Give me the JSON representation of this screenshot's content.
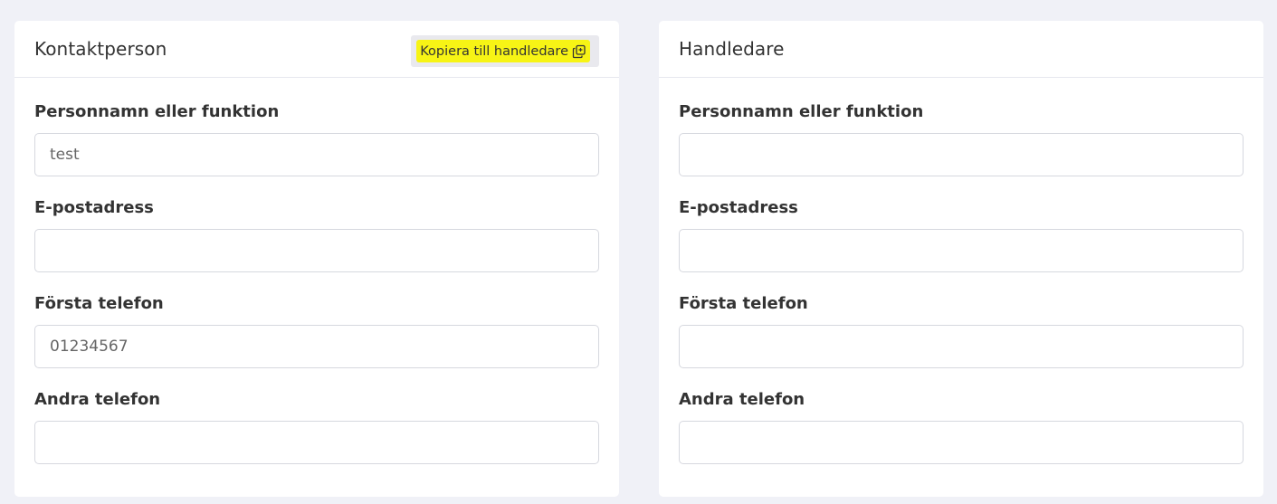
{
  "contact": {
    "title": "Kontaktperson",
    "copy_button_label": "Kopiera till handledare",
    "copy_icon": "copy-icon",
    "highlight_color": "#f7f415",
    "fields": [
      {
        "label": "Personnamn eller funktion",
        "value": "test"
      },
      {
        "label": "E-postadress",
        "value": ""
      },
      {
        "label": "Första telefon",
        "value": "01234567"
      },
      {
        "label": "Andra telefon",
        "value": ""
      }
    ]
  },
  "supervisor": {
    "title": "Handledare",
    "fields": [
      {
        "label": "Personnamn eller funktion",
        "value": ""
      },
      {
        "label": "E-postadress",
        "value": ""
      },
      {
        "label": "Första telefon",
        "value": ""
      },
      {
        "label": "Andra telefon",
        "value": ""
      }
    ]
  }
}
